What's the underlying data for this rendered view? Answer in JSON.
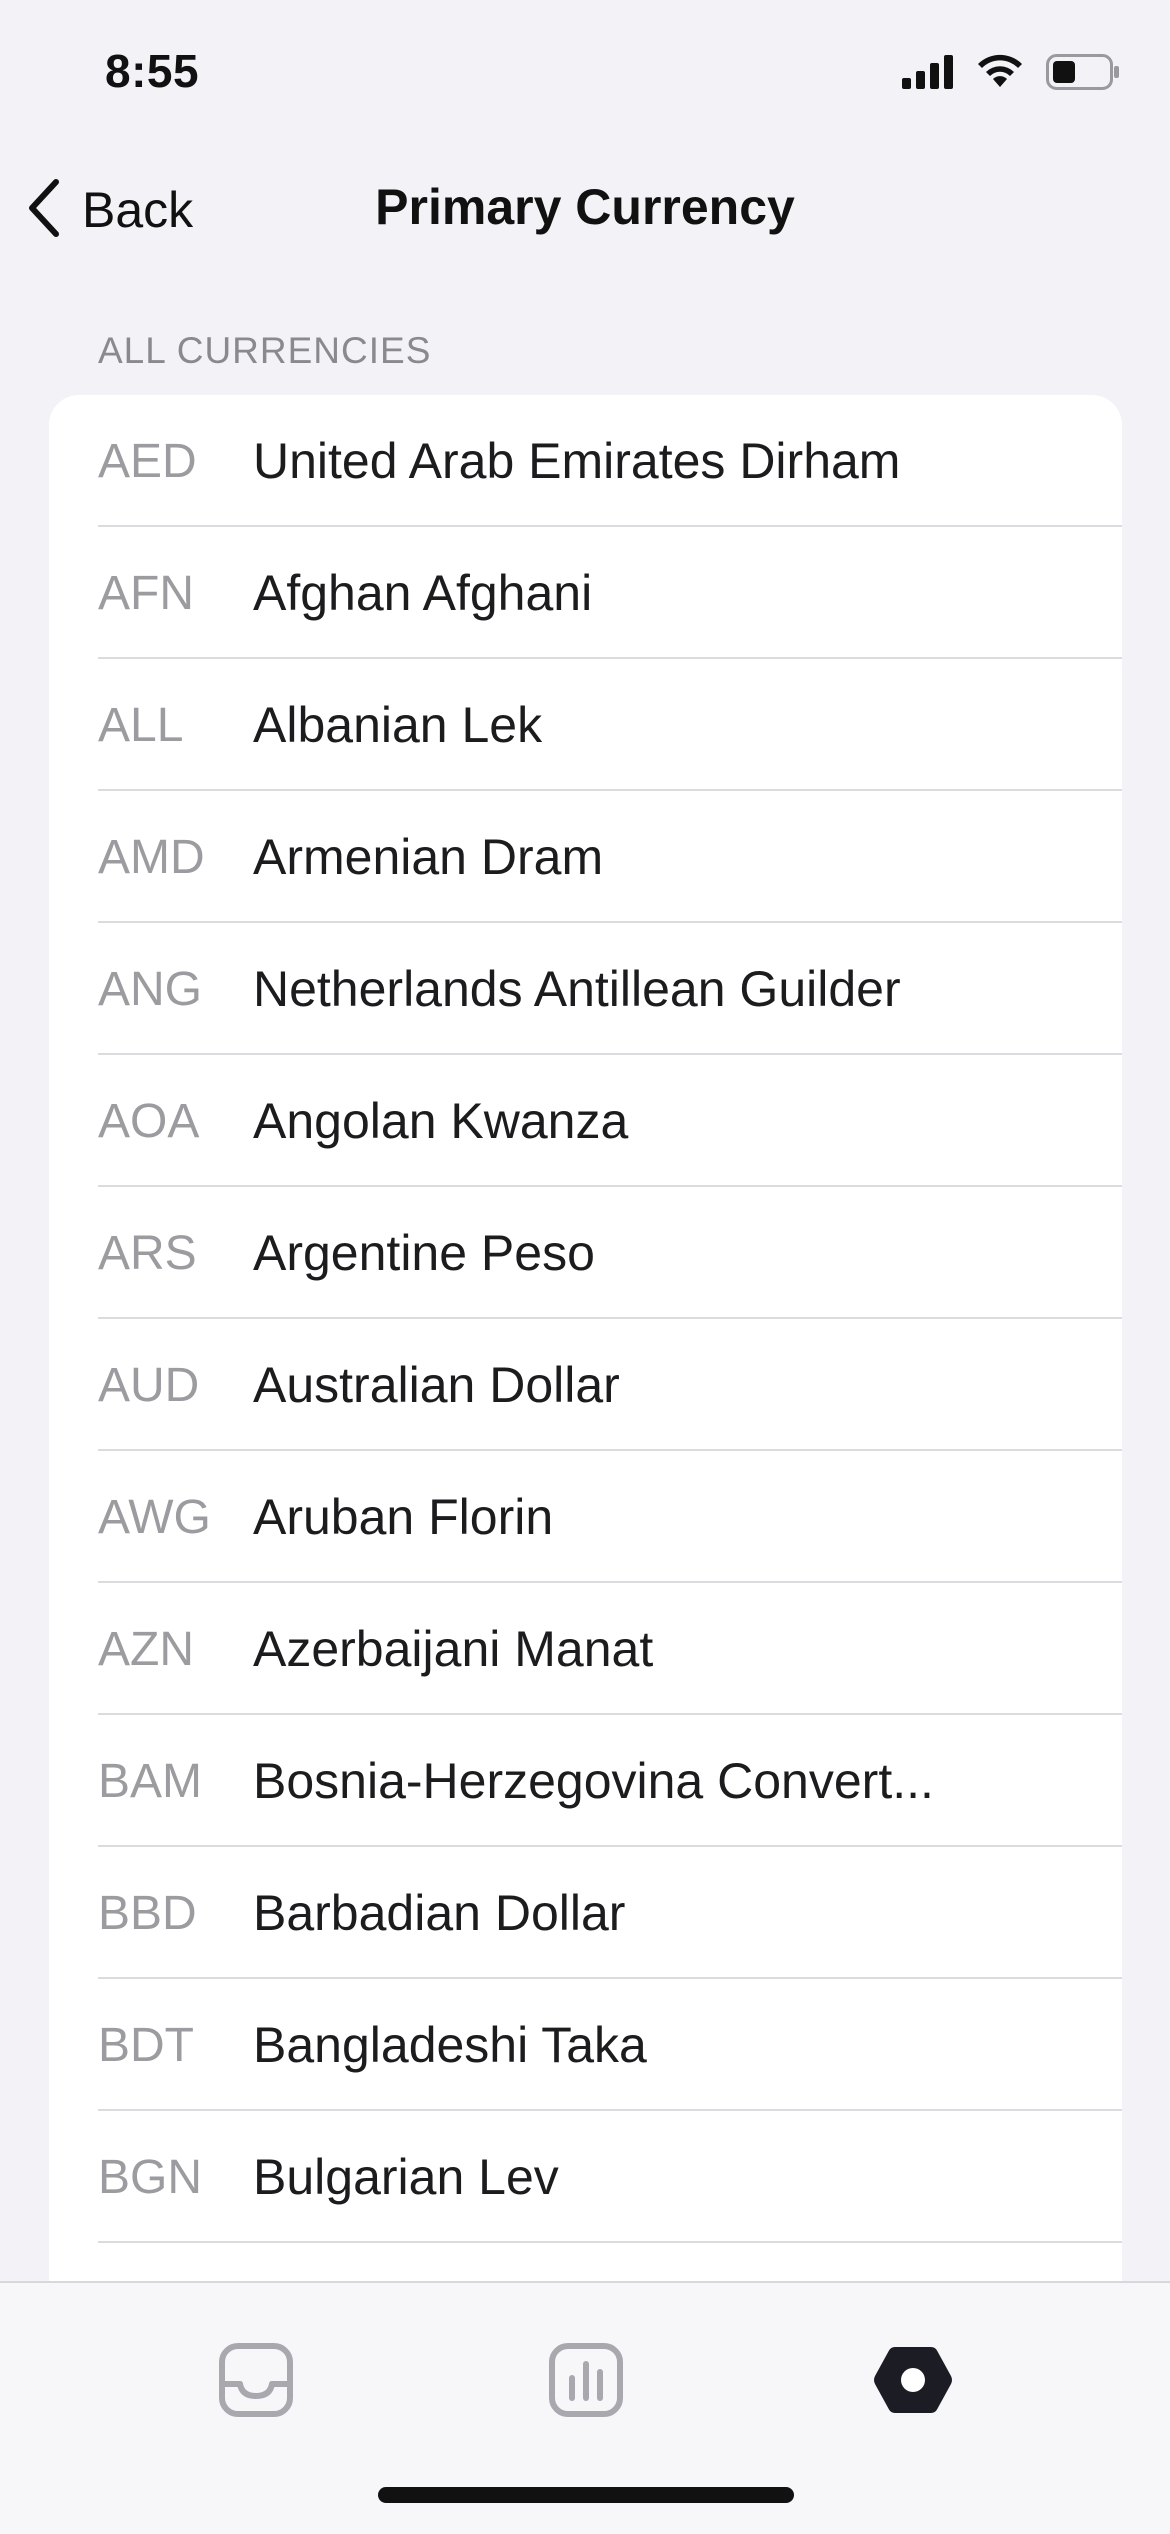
{
  "status_bar": {
    "time": "8:55",
    "icons": [
      "cellular-signal-icon",
      "wifi-icon",
      "battery-icon"
    ]
  },
  "nav": {
    "back_label": "Back",
    "title": "Primary Currency"
  },
  "section": {
    "header": "ALL CURRENCIES"
  },
  "currencies": [
    {
      "code": "AED",
      "name": "United Arab Emirates Dirham"
    },
    {
      "code": "AFN",
      "name": "Afghan Afghani"
    },
    {
      "code": "ALL",
      "name": "Albanian Lek"
    },
    {
      "code": "AMD",
      "name": "Armenian Dram"
    },
    {
      "code": "ANG",
      "name": "Netherlands Antillean Guilder"
    },
    {
      "code": "AOA",
      "name": "Angolan Kwanza"
    },
    {
      "code": "ARS",
      "name": "Argentine Peso"
    },
    {
      "code": "AUD",
      "name": "Australian Dollar"
    },
    {
      "code": "AWG",
      "name": "Aruban Florin"
    },
    {
      "code": "AZN",
      "name": "Azerbaijani Manat"
    },
    {
      "code": "BAM",
      "name": "Bosnia-Herzegovina Convert..."
    },
    {
      "code": "BBD",
      "name": "Barbadian Dollar"
    },
    {
      "code": "BDT",
      "name": "Bangladeshi Taka"
    },
    {
      "code": "BGN",
      "name": "Bulgarian Lev"
    }
  ],
  "tab_bar": {
    "tabs": [
      {
        "icon": "inbox-tray-icon",
        "active": false
      },
      {
        "icon": "bar-chart-icon",
        "active": false
      },
      {
        "icon": "settings-hexagon-icon",
        "active": true
      }
    ]
  },
  "colors": {
    "background": "#f2f2f7",
    "card": "#ffffff",
    "secondary_text": "#9b9ba0",
    "active_tab": "#1c1c24",
    "inactive_tab": "#a8a8ae"
  }
}
